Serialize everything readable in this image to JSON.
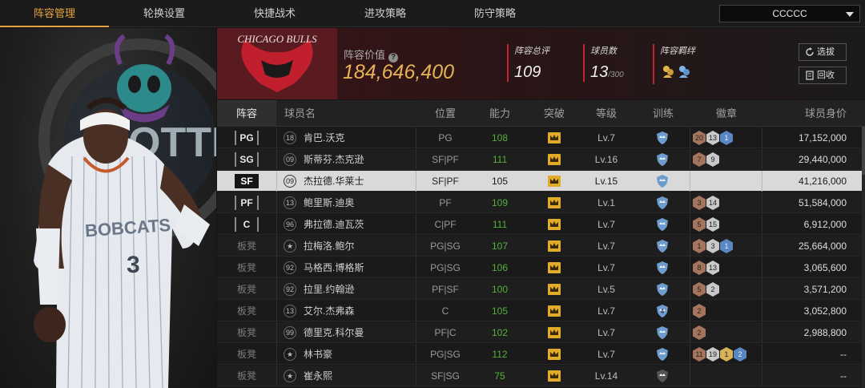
{
  "tabs": [
    {
      "label": "阵容管理",
      "active": true
    },
    {
      "label": "轮换设置",
      "active": false
    },
    {
      "label": "快捷战术",
      "active": false
    },
    {
      "label": "进攻策略",
      "active": false
    },
    {
      "label": "防守策略",
      "active": false
    }
  ],
  "team_select": {
    "value": "CCCCC"
  },
  "banner": {
    "logo_text": "CHICAGO BULLS",
    "value_label": "阵容价值",
    "value": "184,646,400",
    "stats": [
      {
        "label": "阵容总评",
        "value": "109",
        "suffix": ""
      },
      {
        "label": "球员数",
        "value": "13",
        "suffix": "/300"
      },
      {
        "label": "阵容羁绊",
        "value": "",
        "suffix": ""
      }
    ],
    "buttons": {
      "select": "选拔",
      "recycle": "回收"
    }
  },
  "hero": {
    "jersey_text": "BOBCATS",
    "jersey_number": "3",
    "backdrop_text": "OTTE"
  },
  "table": {
    "headers": {
      "lineup": "阵容",
      "name": "球员名",
      "position": "位置",
      "ability": "能力",
      "breakthrough": "突破",
      "level": "等级",
      "training": "训练",
      "badges": "徽章",
      "value": "球员身价"
    },
    "rows": [
      {
        "slot": "PG",
        "num": "18",
        "name": "肯巴.沃克",
        "pos": "PG",
        "ability": "108",
        "level": "Lv.7",
        "training": "",
        "badges": [
          {
            "t": "20",
            "c": "bronze"
          },
          {
            "t": "13",
            "c": "silver"
          },
          {
            "t": "1",
            "c": "blue"
          }
        ],
        "value": "17,152,000"
      },
      {
        "slot": "SG",
        "num": "09",
        "name": "斯蒂芬.杰克逊",
        "pos": "SF|PF",
        "ability": "111",
        "level": "Lv.16",
        "training": "",
        "badges": [
          {
            "t": "7",
            "c": "bronze"
          },
          {
            "t": "9",
            "c": "silver"
          }
        ],
        "value": "29,440,000"
      },
      {
        "slot": "SF",
        "num": "09",
        "name": "杰拉德.华莱士",
        "pos": "SF|PF",
        "ability": "105",
        "level": "Lv.15",
        "training": "",
        "badges": [],
        "value": "41,216,000",
        "selected": true
      },
      {
        "slot": "PF",
        "num": "13",
        "name": "鲍里斯.迪奥",
        "pos": "PF",
        "ability": "109",
        "level": "Lv.1",
        "training": "",
        "badges": [
          {
            "t": "3",
            "c": "bronze"
          },
          {
            "t": "14",
            "c": "silver"
          }
        ],
        "value": "51,584,000"
      },
      {
        "slot": "C",
        "num": "96",
        "name": "弗拉德.迪瓦茨",
        "pos": "C|PF",
        "ability": "111",
        "level": "Lv.7",
        "training": "",
        "badges": [
          {
            "t": "5",
            "c": "bronze"
          },
          {
            "t": "15",
            "c": "silver"
          }
        ],
        "value": "6,912,000"
      },
      {
        "slot": "板凳",
        "num": "",
        "name": "拉梅洛.鲍尔",
        "pos": "PG|SG",
        "ability": "107",
        "level": "Lv.7",
        "training": "",
        "badges": [
          {
            "t": "1",
            "c": "bronze"
          },
          {
            "t": "3",
            "c": "silver"
          },
          {
            "t": "1",
            "c": "blue"
          }
        ],
        "value": "25,664,000"
      },
      {
        "slot": "板凳",
        "num": "92",
        "name": "马格西.博格斯",
        "pos": "PG|SG",
        "ability": "106",
        "level": "Lv.7",
        "training": "",
        "badges": [
          {
            "t": "8",
            "c": "bronze"
          },
          {
            "t": "13",
            "c": "silver"
          }
        ],
        "value": "3,065,600"
      },
      {
        "slot": "板凳",
        "num": "92",
        "name": "拉里.约翰逊",
        "pos": "PF|SF",
        "ability": "100",
        "level": "Lv.5",
        "training": "",
        "badges": [
          {
            "t": "5",
            "c": "bronze"
          },
          {
            "t": "2",
            "c": "silver"
          }
        ],
        "value": "3,571,200"
      },
      {
        "slot": "板凳",
        "num": "13",
        "name": "艾尔.杰弗森",
        "pos": "C",
        "ability": "105",
        "level": "Lv.7",
        "training": "4",
        "badges": [
          {
            "t": "2",
            "c": "bronze"
          }
        ],
        "value": "3,052,800"
      },
      {
        "slot": "板凳",
        "num": "99",
        "name": "德里克.科尔曼",
        "pos": "PF|C",
        "ability": "102",
        "level": "Lv.7",
        "training": "",
        "badges": [
          {
            "t": "2",
            "c": "bronze"
          }
        ],
        "value": "2,988,800"
      },
      {
        "slot": "板凳",
        "num": "",
        "name": "林书豪",
        "pos": "PG|SG",
        "ability": "112",
        "level": "Lv.7",
        "training": "",
        "badges": [
          {
            "t": "11",
            "c": "bronze"
          },
          {
            "t": "19",
            "c": "silver"
          },
          {
            "t": "1",
            "c": "gold"
          },
          {
            "t": "2",
            "c": "blue"
          }
        ],
        "value": "--"
      },
      {
        "slot": "板凳",
        "num": "",
        "name": "崔永熙",
        "pos": "SF|SG",
        "ability": "75",
        "level": "Lv.14",
        "training": "",
        "badges": [],
        "value": "--"
      }
    ]
  },
  "colors": {
    "accent": "#e9a23b",
    "ability_green": "#54b03c",
    "banner_red": "#5a1b20"
  }
}
